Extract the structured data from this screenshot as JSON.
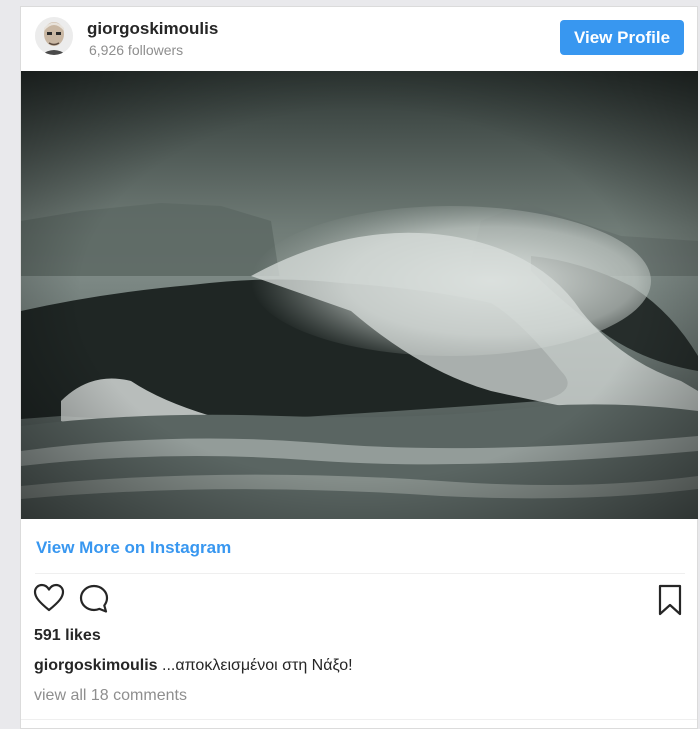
{
  "profile": {
    "username": "giorgoskimoulis",
    "followers": "6,926 followers",
    "view_profile_label": "View Profile"
  },
  "post": {
    "photo_alt": "Stormy sea waves crashing over a rocky islet",
    "view_more_label": "View More on Instagram",
    "likes": "591 likes",
    "caption_user": "giorgoskimoulis",
    "caption_text": "...αποκλεισμένοι στη Νάξο!",
    "comments_link": "view all 18 comments"
  },
  "icons": {
    "like": "heart-icon",
    "comment": "comment-icon",
    "save": "bookmark-icon"
  },
  "colors": {
    "accent": "#3897f0",
    "text": "#262626",
    "muted": "#8e8e8e"
  }
}
